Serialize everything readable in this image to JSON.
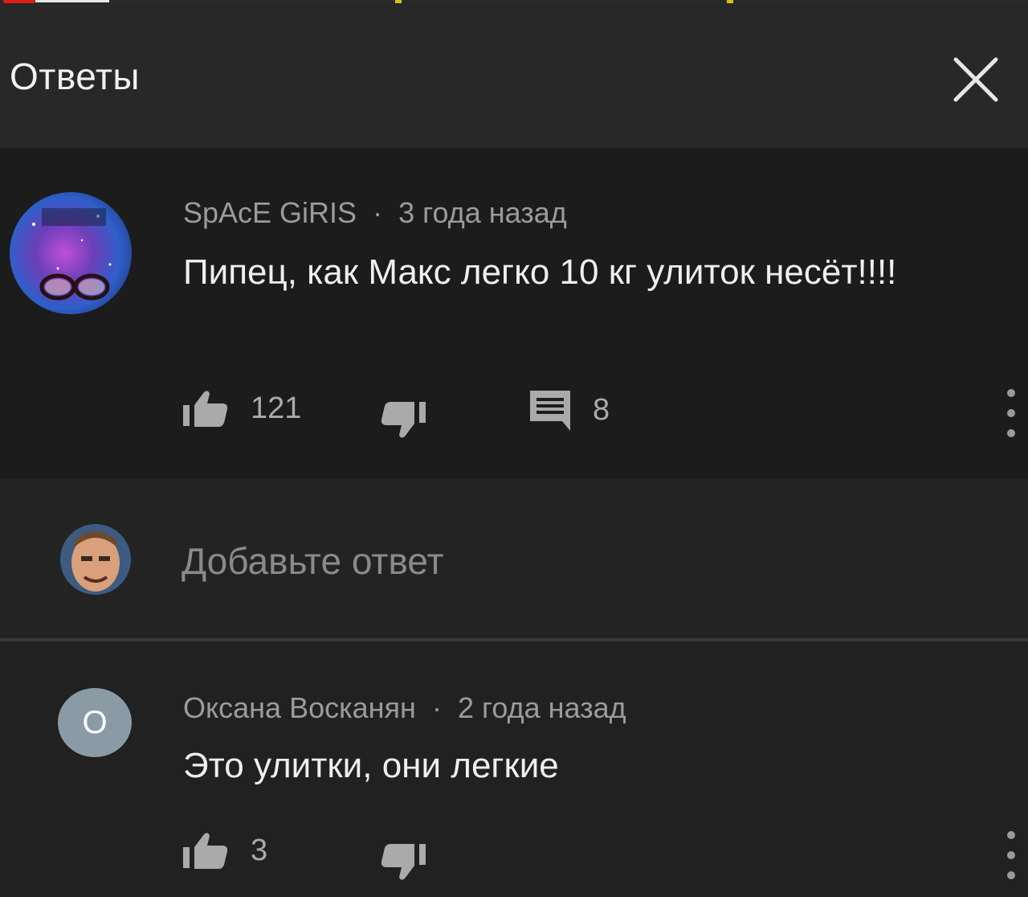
{
  "header": {
    "title": "Ответы",
    "close_icon": "close-icon"
  },
  "comment": {
    "author": "SpAcE GiRIS",
    "separator": "·",
    "time": "3 года назад",
    "text": "Пипец, как Макс легко 10 кг улиток несёт!!!!",
    "likes": "121",
    "replies": "8",
    "icons": [
      "thumb-up-icon",
      "thumb-down-icon",
      "comment-icon",
      "more-vert-icon"
    ]
  },
  "reply_box": {
    "placeholder": "Добавьте ответ"
  },
  "reply": {
    "avatar_letter": "O",
    "author": "Оксана Восканян",
    "separator": "·",
    "time": "2 года назад",
    "text": "Это улитки, они легкие",
    "likes": "3",
    "avatar_color": "#8a9ba6"
  },
  "colors": {
    "background": "#212121",
    "header": "#282828",
    "card": "#1c1c1c",
    "text_primary": "#efefef",
    "text_secondary": "#9b9b9b",
    "progress_red": "#e01b1b"
  }
}
